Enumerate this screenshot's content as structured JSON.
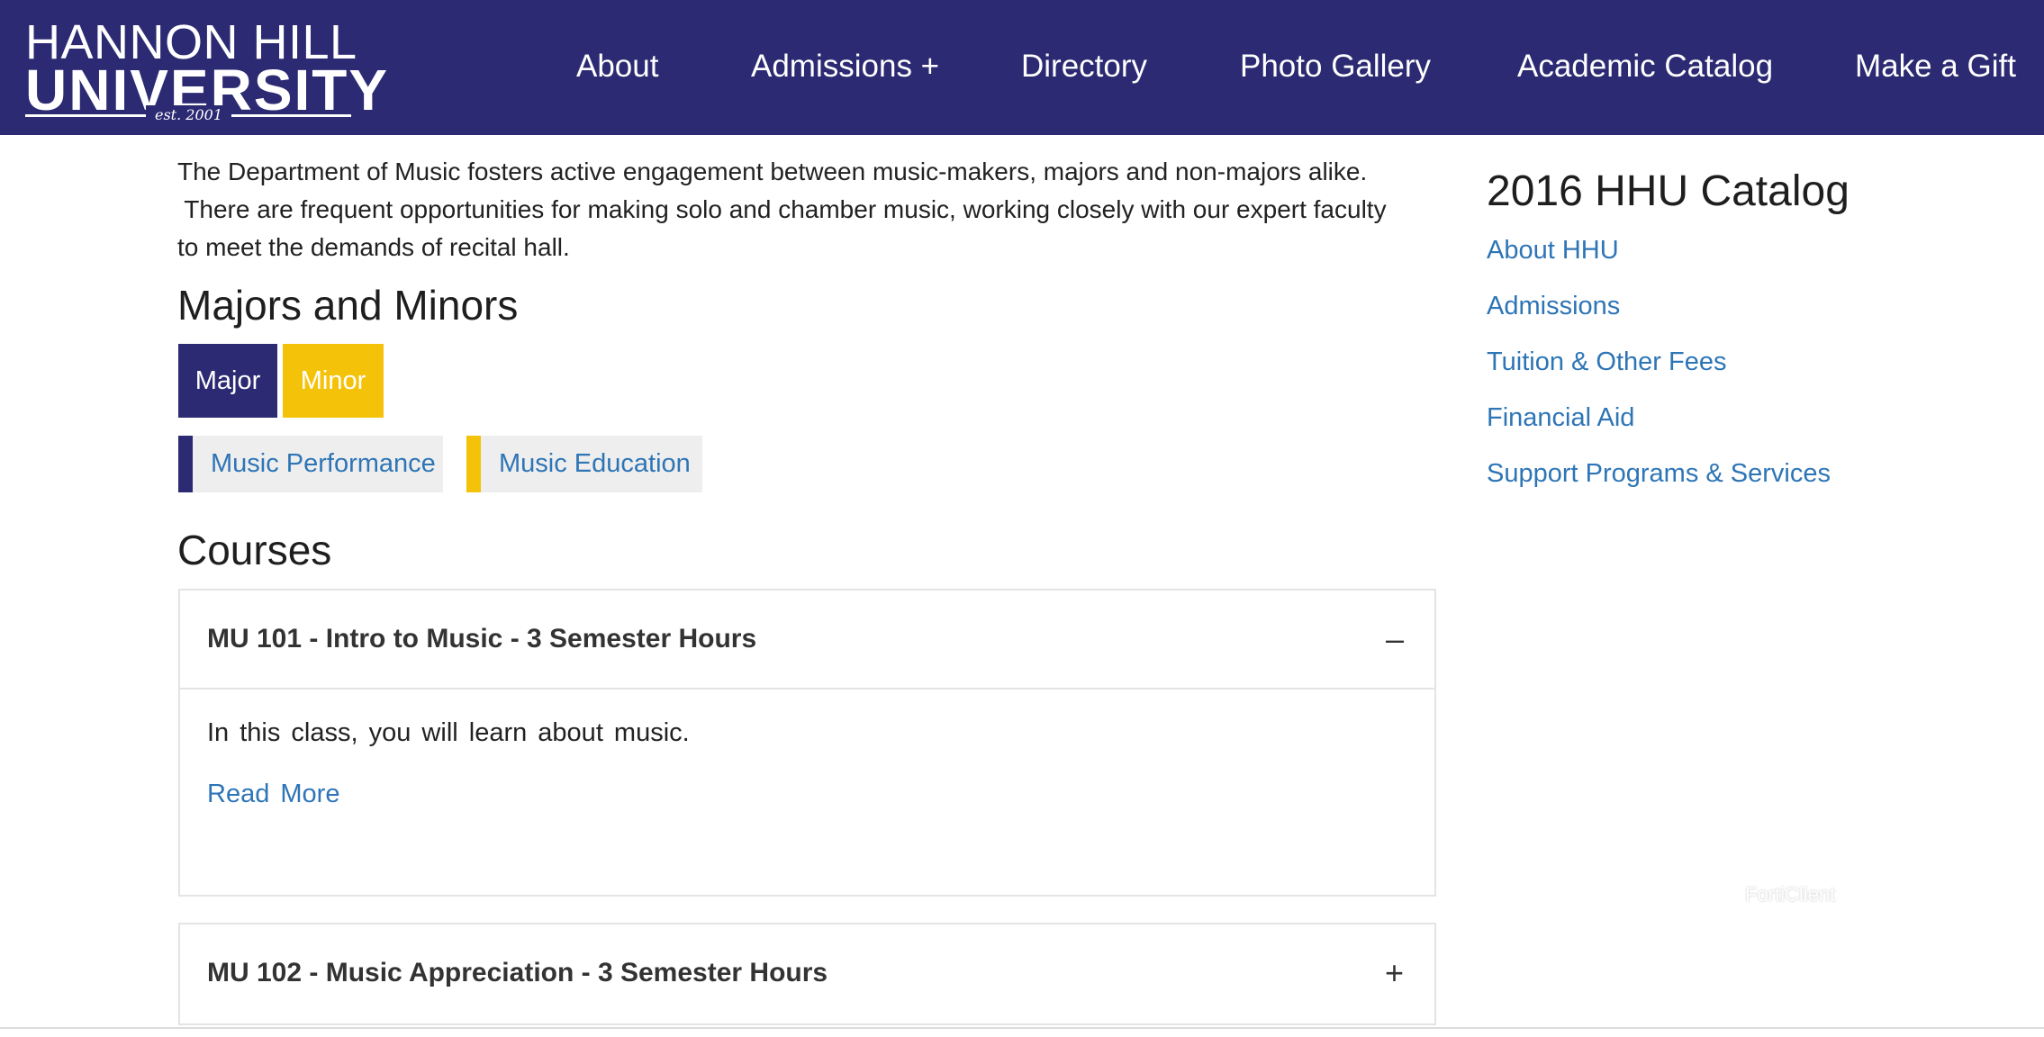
{
  "header": {
    "logo": {
      "line1": "HANNON HILL",
      "line2": "UNIVERSITY",
      "est": "est. 2001"
    },
    "nav": [
      "About",
      "Admissions +",
      "Directory",
      "Photo Gallery",
      "Academic Catalog",
      "Make a Gift"
    ]
  },
  "main": {
    "intro_line1": "The Department of Music fosters active engagement between music-makers, majors and non-majors alike.",
    "intro_line2": " There are frequent opportunities for making solo and chamber music, working closely with our expert faculty",
    "intro_line3": "to meet the demands of recital hall.",
    "majors_heading": "Majors and Minors",
    "filters": [
      "Major",
      "Minor"
    ],
    "programs": [
      "Music Performance",
      "Music Education"
    ],
    "courses_heading": "Courses",
    "courses": [
      {
        "title": "MU 101 - Intro to Music - 3 Semester Hours",
        "toggle": "–",
        "description": "In this class, you will learn about music.",
        "link": "Read More"
      },
      {
        "title": "MU 102 - Music Appreciation - 3 Semester Hours",
        "toggle": "+"
      }
    ]
  },
  "sidebar": {
    "title": "2016 HHU Catalog",
    "links": [
      "About HHU",
      "Admissions",
      "Tuition & Other Fees",
      "Financial Aid",
      "Support Programs & Services"
    ]
  },
  "overlay": {
    "watermark": "FortiClient"
  },
  "colors": {
    "brand_navy": "#2c2a72",
    "accent_yellow": "#f5c20a",
    "link_blue": "#2e75b6"
  }
}
